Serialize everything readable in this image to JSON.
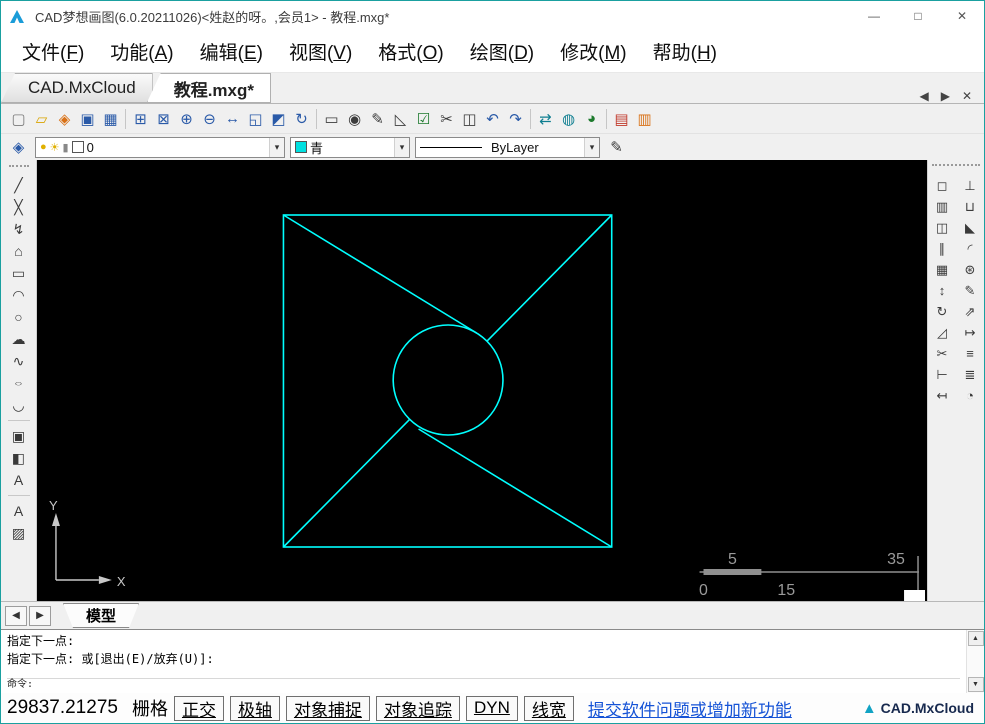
{
  "window": {
    "title": "CAD梦想画图(6.0.20211026)<姓赵的呀。,会员1> - 教程.mxg*",
    "controls": {
      "minimize": "—",
      "maximize": "□",
      "close": "✕"
    }
  },
  "menu": {
    "items": [
      {
        "pre": "文件(",
        "key": "F",
        "post": ")"
      },
      {
        "pre": "功能(",
        "key": "A",
        "post": ")"
      },
      {
        "pre": "编辑(",
        "key": "E",
        "post": ")"
      },
      {
        "pre": "视图(",
        "key": "V",
        "post": ")"
      },
      {
        "pre": "格式(",
        "key": "O",
        "post": ")"
      },
      {
        "pre": "绘图(",
        "key": "D",
        "post": ")"
      },
      {
        "pre": "修改(",
        "key": "M",
        "post": ")"
      },
      {
        "pre": "帮助(",
        "key": "H",
        "post": ")"
      }
    ]
  },
  "tabbar": {
    "tabs": [
      {
        "label": "CAD.MxCloud",
        "active": false
      },
      {
        "label": "教程.mxg*",
        "active": true
      }
    ],
    "prev": "◀",
    "next": "▶",
    "close": "✕"
  },
  "toolbar2": {
    "layer": {
      "name": "0"
    },
    "color": {
      "name": "青",
      "hex": "#00e0e0"
    },
    "linetype": {
      "name": "ByLayer"
    }
  },
  "icons": {
    "new-file": "▢",
    "open-file": "▱",
    "cloud-open": "◈",
    "save": "▣",
    "save-as": "▦",
    "zoom-window": "⊞",
    "zoom-dynamic": "⊠",
    "zoom-in": "⊕",
    "zoom-out": "⊖",
    "pan": "↔",
    "zoom-extents": "◱",
    "zoom-all": "◩",
    "regen": "↻",
    "select": "▭",
    "magnify": "◉",
    "pen": "✎",
    "dimension": "◺",
    "check": "☑",
    "cut": "✂",
    "erase": "◫",
    "undo": "↶",
    "redo": "↷",
    "sync": "⇄",
    "web": "◍",
    "compass": "◕",
    "pdf": "▤",
    "image": "▥",
    "line": "╱",
    "xline": "╳",
    "polyline": "↯",
    "polygon": "⌂",
    "rectangle": "▭",
    "arc": "◠",
    "circle": "○",
    "revcloud": "☁",
    "spline": "∿",
    "ellipse": "○",
    "ellipse-arc": "◡",
    "insert-block": "▣",
    "make-block": "◧",
    "text": "A",
    "mtext": "A",
    "hatch": "▨",
    "modify-erase": "◻",
    "break": "⊥",
    "copy": "▥",
    "join": "⊔",
    "mirror": "◫",
    "chamfer": "◣",
    "offset": "∥",
    "fillet": "◜",
    "array": "▦",
    "explode": "⊛",
    "move": "↕",
    "pedit": "✎",
    "rotate": "↻",
    "stretch": "⇗",
    "scale": "◿",
    "lengthen": "↦",
    "trim": "✂",
    "align": "≡",
    "extend": "⊢",
    "props": "≣",
    "dim-linear": "↤",
    "dim-radius": "◔",
    "layer-manager": "◈",
    "bulb": "●",
    "sun": "☀",
    "lock": "▮",
    "dropdown": "▾",
    "match-props": "✎"
  },
  "canvas": {
    "drawing": {
      "color": "#00ffff",
      "shapes": [
        "square",
        "inscribed-circle",
        "trimmed-diagonal",
        "tangent-from-top-left",
        "tangent-from-bottom-right"
      ]
    },
    "ucs": {
      "x_label": "X",
      "y_label": "Y"
    },
    "ruler": {
      "labels_top": [
        "5",
        "35"
      ],
      "labels_bottom": [
        "0",
        "15"
      ]
    }
  },
  "model_bar": {
    "prev": "◀",
    "next": "▶",
    "tab": "模型"
  },
  "command": {
    "lines": [
      "指定下一点:",
      "指定下一点: 或[退出(E)/放弃(U)]:"
    ],
    "prompt": "命令:",
    "scroll_up": "▲",
    "scroll_down": "▼"
  },
  "statusbar": {
    "coords": "29837.21275",
    "grid": "栅格",
    "toggles": [
      "正交",
      "极轴",
      "对象捕捉",
      "对象追踪",
      "DYN",
      "线宽"
    ],
    "link": "提交软件问题或增加新功能",
    "brand": "CAD.MxCloud"
  }
}
